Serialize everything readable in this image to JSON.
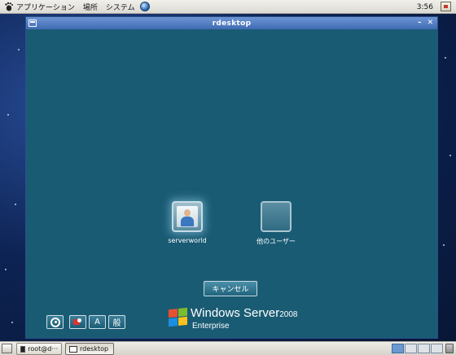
{
  "top_panel": {
    "menus": [
      "アプリケーション",
      "場所",
      "システム"
    ],
    "clock": "3:56"
  },
  "window": {
    "title": "rdesktop",
    "minimize_glyph": "–",
    "close_glyph": "✕"
  },
  "login": {
    "users": [
      {
        "label": "serverworld",
        "icon": "user-photo-icon"
      },
      {
        "label": "他のユーザー",
        "icon": "blank-user-icon"
      }
    ],
    "cancel_label": "キャンセル",
    "accessibility_buttons": [
      {
        "name": "ease-of-access-button",
        "icon": "ease-of-access-icon",
        "text": ""
      },
      {
        "name": "language-bar-button",
        "icon": "language-flag-icon",
        "text": ""
      },
      {
        "name": "ime-mode-button",
        "icon": "",
        "text": "A"
      },
      {
        "name": "ime-kana-button",
        "icon": "",
        "text": "般"
      }
    ],
    "branding": {
      "product": "Windows Server",
      "version": "2008",
      "edition": "Enterprise"
    }
  },
  "taskbar": {
    "tasks": [
      {
        "label": "root@d···",
        "icon": "terminal-icon",
        "active": false
      },
      {
        "label": "rdesktop",
        "icon": "window-icon",
        "active": true
      }
    ],
    "workspaces": 4,
    "current_workspace": 1
  },
  "colors": {
    "login_background": "#1a5b74",
    "titlebar": "#4a76bd",
    "desktop": "#0d2353"
  }
}
